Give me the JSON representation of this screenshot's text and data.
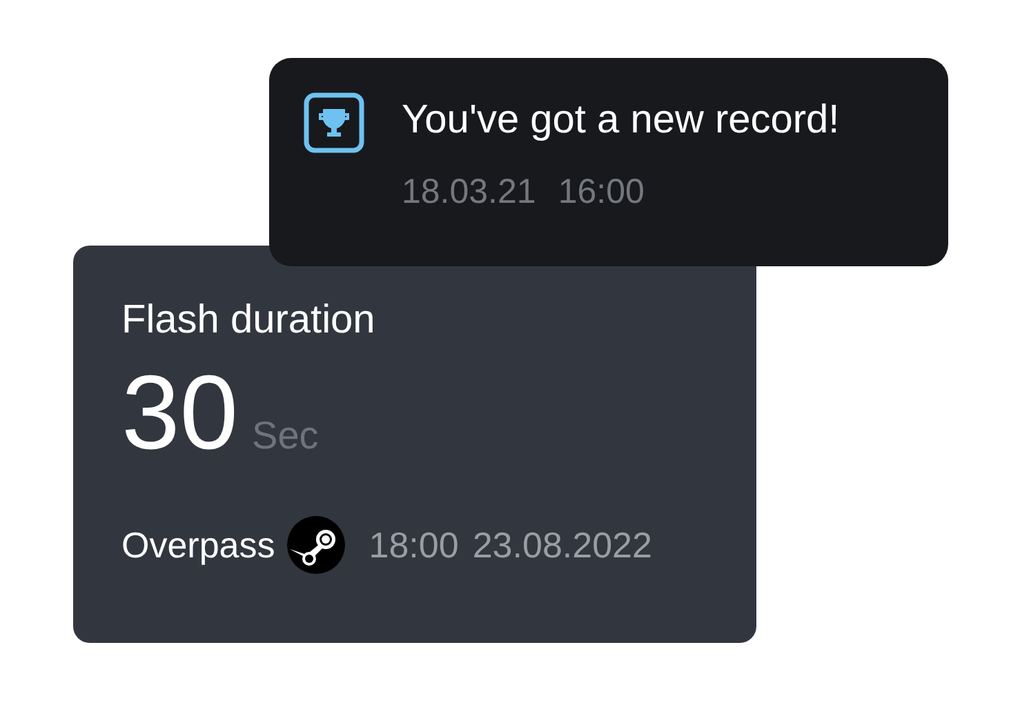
{
  "notification": {
    "title": "You've got a new record!",
    "date": "18.03.21",
    "time": "16:00"
  },
  "card": {
    "title": "Flash duration",
    "value": "30",
    "unit": "Sec",
    "map": "Overpass",
    "time": "18:00",
    "date": "23.08.2022"
  }
}
